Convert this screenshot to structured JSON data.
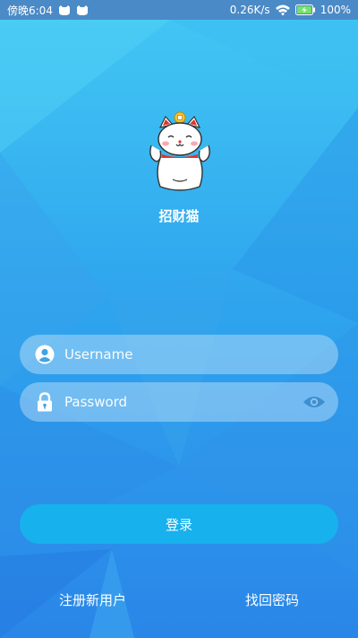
{
  "status_bar": {
    "time": "傍晚6:04",
    "network_speed": "0.26K/s",
    "battery": "100%",
    "icons": [
      "notification-cat-icon",
      "notification-cat-icon",
      "wifi-icon",
      "battery-charging-icon"
    ]
  },
  "app": {
    "name": "招财猫",
    "logo_icon": "lucky-cat-logo"
  },
  "form": {
    "username_placeholder": "Username",
    "username_value": "",
    "password_placeholder": "Password",
    "password_value": "",
    "login_label": "登录"
  },
  "links": {
    "register": "注册新用户",
    "forgot_password": "找回密码"
  },
  "colors": {
    "background_top": "#43c8f4",
    "background_bottom": "#2a86e8",
    "status_bar": "#4a8ac6",
    "login_button": "#17b1ee",
    "field_icon": "#ffffff",
    "eye_icon": "#3c8fd0"
  }
}
